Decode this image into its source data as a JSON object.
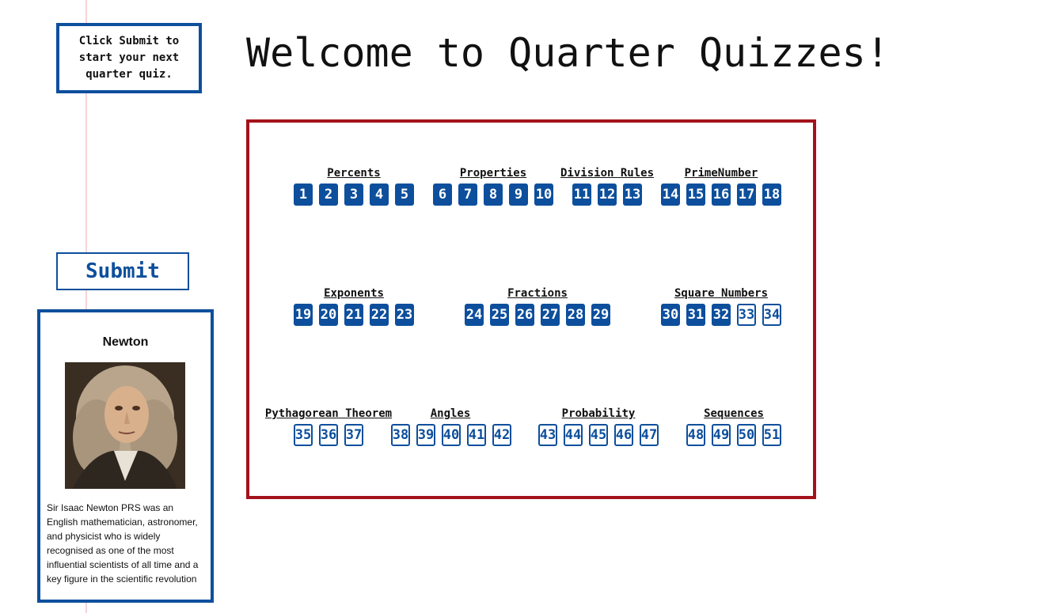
{
  "header": {
    "title": "Welcome to Quarter Quizzes!",
    "instructions": "Click Submit to start your next quarter quiz."
  },
  "submit_label": "Submit",
  "mathematician": {
    "name": "Newton",
    "bio": "Sir Isaac Newton PRS was an English mathematician, astronomer, and physicist who is widely recognised as one of the most influential scientists of all time and a key figure in the scientific revolution"
  },
  "colors": {
    "accent": "#0d4f9c",
    "board_border": "#a3121b",
    "notebook_line": "#dde6f4",
    "margin_line": "#f6d4d8"
  },
  "categories": [
    {
      "label": "Percents"
    },
    {
      "label": "Properties"
    },
    {
      "label": "Division Rules"
    },
    {
      "label": "PrimeNumber"
    },
    {
      "label": "Exponents"
    },
    {
      "label": "Fractions"
    },
    {
      "label": "Square Numbers"
    },
    {
      "label": "Pythagorean Theorem"
    },
    {
      "label": "Angles"
    },
    {
      "label": "Probability"
    },
    {
      "label": "Sequences"
    }
  ],
  "quizzes": [
    {
      "label": "1",
      "done": true
    },
    {
      "label": "2",
      "done": true
    },
    {
      "label": "3",
      "done": true
    },
    {
      "label": "4",
      "done": true
    },
    {
      "label": "5",
      "done": true
    },
    {
      "label": "6",
      "done": true
    },
    {
      "label": "7",
      "done": true
    },
    {
      "label": "8",
      "done": true
    },
    {
      "label": "9",
      "done": true
    },
    {
      "label": "10",
      "done": true
    },
    {
      "label": "11",
      "done": true
    },
    {
      "label": "12",
      "done": true
    },
    {
      "label": "13",
      "done": true
    },
    {
      "label": "14",
      "done": true
    },
    {
      "label": "15",
      "done": true
    },
    {
      "label": "16",
      "done": true
    },
    {
      "label": "17",
      "done": true
    },
    {
      "label": "18",
      "done": true
    },
    {
      "label": "19",
      "done": true
    },
    {
      "label": "20",
      "done": true
    },
    {
      "label": "21",
      "done": true
    },
    {
      "label": "22",
      "done": true
    },
    {
      "label": "23",
      "done": true
    },
    {
      "label": "24",
      "done": true
    },
    {
      "label": "25",
      "done": true
    },
    {
      "label": "26",
      "done": true
    },
    {
      "label": "27",
      "done": true
    },
    {
      "label": "28",
      "done": true
    },
    {
      "label": "29",
      "done": true
    },
    {
      "label": "30",
      "done": true
    },
    {
      "label": "31",
      "done": true
    },
    {
      "label": "32",
      "done": true
    },
    {
      "label": "33",
      "done": false
    },
    {
      "label": "34",
      "done": false
    },
    {
      "label": "35",
      "done": false
    },
    {
      "label": "36",
      "done": false
    },
    {
      "label": "37",
      "done": false
    },
    {
      "label": "38",
      "done": false
    },
    {
      "label": "39",
      "done": false
    },
    {
      "label": "40",
      "done": false
    },
    {
      "label": "41",
      "done": false
    },
    {
      "label": "42",
      "done": false
    },
    {
      "label": "43",
      "done": false
    },
    {
      "label": "44",
      "done": false
    },
    {
      "label": "45",
      "done": false
    },
    {
      "label": "46",
      "done": false
    },
    {
      "label": "47",
      "done": false
    },
    {
      "label": "48",
      "done": false
    },
    {
      "label": "49",
      "done": false
    },
    {
      "label": "50",
      "done": false
    },
    {
      "label": "51",
      "done": false
    }
  ]
}
